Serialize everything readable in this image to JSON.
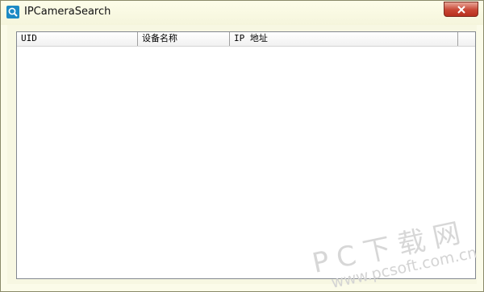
{
  "window": {
    "title": "IPCameraSearch",
    "app_icon": "search-magnifier-icon",
    "close_icon": "close-icon",
    "close_color": "#c84634"
  },
  "listview": {
    "columns": [
      "UID",
      "设备名称",
      "IP 地址"
    ],
    "rows": []
  },
  "watermark": {
    "title": "PC下载网",
    "url": "www.pcsoft.com.cn"
  }
}
